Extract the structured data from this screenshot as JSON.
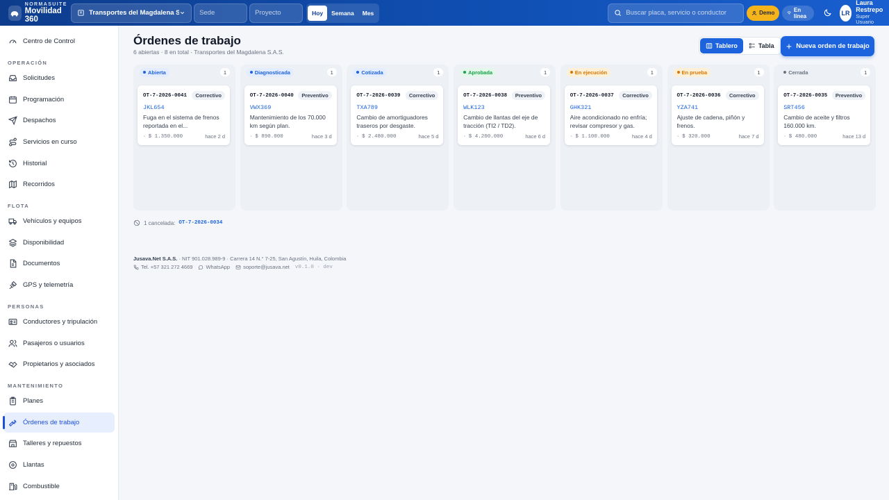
{
  "brand": {
    "small": "NORMASUITE",
    "big": "Movilidad 360"
  },
  "topbar": {
    "company": "Transportes del Magdalena S.A...",
    "sede_placeholder": "Sede",
    "proyecto_placeholder": "Proyecto",
    "periods": [
      "Hoy",
      "Semana",
      "Mes"
    ],
    "search_placeholder": "Buscar placa, servicio o conductor",
    "demo_label": "Demo",
    "online_label": "En línea",
    "user": {
      "initials": "LR",
      "name": "Laura Restrepo",
      "role": "Super Usuario"
    }
  },
  "sidebar": {
    "top_item": "Centro de Control",
    "sections": {
      "operacion": "OPERACIÓN",
      "flota": "FLOTA",
      "personas": "PERSONAS",
      "mantenimiento": "MANTENIMIENTO"
    },
    "items": {
      "solicitudes": "Solicitudes",
      "programacion": "Programación",
      "despachos": "Despachos",
      "servicios": "Servicios en curso",
      "historial": "Historial",
      "recorridos": "Recorridos",
      "vehiculos": "Vehículos y equipos",
      "disponibilidad": "Disponibilidad",
      "documentos": "Documentos",
      "gps": "GPS y telemetría",
      "conductores": "Conductores y tripulación",
      "pasajeros": "Pasajeros o usuarios",
      "propietarios": "Propietarios y asociados",
      "planes": "Planes",
      "ordenes": "Órdenes de trabajo",
      "talleres": "Talleres y repuestos",
      "llantas": "Llantas",
      "combustible": "Combustible"
    }
  },
  "main": {
    "title": "Órdenes de trabajo",
    "subtitle": "6 abiertas · 8 en total · Transportes del Magdalena S.A.S.",
    "view_board": "Tablero",
    "view_table": "Tabla",
    "new_order": "Nueva orden de trabajo",
    "columns": [
      {
        "status": "Abierta",
        "count": "1",
        "color": "#1d63dd",
        "bg": "#e3edff",
        "card": {
          "code": "OT-7-2026-0041",
          "type": "Correctivo",
          "plate": "JKL654",
          "desc": "Fuga en el sistema de frenos reportada en el...",
          "cost": "$ 1.350.000",
          "age": "hace 2 d"
        }
      },
      {
        "status": "Diagnosticada",
        "count": "1",
        "color": "#1d63dd",
        "bg": "#e3edff",
        "card": {
          "code": "OT-7-2026-0040",
          "type": "Preventivo",
          "plate": "VWX369",
          "desc": "Mantenimiento de los 70.000 km según plan.",
          "cost": "$ 890.000",
          "age": "hace 3 d"
        }
      },
      {
        "status": "Cotizada",
        "count": "1",
        "color": "#1d63dd",
        "bg": "#e3edff",
        "card": {
          "code": "OT-7-2026-0039",
          "type": "Correctivo",
          "plate": "TXA789",
          "desc": "Cambio de amortiguadores traseros por desgaste.",
          "cost": "$ 2.480.000",
          "age": "hace 5 d"
        }
      },
      {
        "status": "Aprobada",
        "count": "1",
        "color": "#16a34a",
        "bg": "#e3f7ea",
        "card": {
          "code": "OT-7-2026-0038",
          "type": "Preventivo",
          "plate": "WLK123",
          "desc": "Cambio de llantas del eje de tracción (TI2 / TD2).",
          "cost": "$ 4.200.000",
          "age": "hace 6 d"
        }
      },
      {
        "status": "En ejecución",
        "count": "1",
        "color": "#d97706",
        "bg": "#fdf0d6",
        "card": {
          "code": "OT-7-2026-0037",
          "type": "Correctivo",
          "plate": "GHK321",
          "desc": "Aire acondicionado no enfría; revisar compresor y gas.",
          "cost": "$ 1.100.000",
          "age": "hace 4 d"
        }
      },
      {
        "status": "En prueba",
        "count": "1",
        "color": "#d97706",
        "bg": "#fdf0d6",
        "card": {
          "code": "OT-7-2026-0036",
          "type": "Correctivo",
          "plate": "YZA741",
          "desc": "Ajuste de cadena, piñón y frenos.",
          "cost": "$ 320.000",
          "age": "hace 7 d"
        }
      },
      {
        "status": "Cerrada",
        "count": "1",
        "color": "#6b7280",
        "bg": "#eceff3",
        "card": {
          "code": "OT-7-2026-0035",
          "type": "Preventivo",
          "plate": "SRT456",
          "desc": "Cambio de aceite y filtros 160.000 km.",
          "cost": "$ 480.000",
          "age": "hace 13 d"
        }
      }
    ],
    "cancelled_label": "1 cancelada:",
    "cancelled_code": "OT-7-2026-0034"
  },
  "footer": {
    "company": "Jusava.Net S.A.S.",
    "address": " · NIT 901.028.989-9 · Carrera 14 N.° 7-25, San Agustín, Huila, Colombia",
    "phone": "Tel. +57 321 272 4669",
    "whatsapp": "WhatsApp",
    "email": "soporte@jusava.net",
    "version": "v0.1.0 · dev"
  },
  "colors": {
    "primary": "#1d63dd",
    "topbar": "#0f4fb3",
    "demo": "#f5b31c"
  }
}
